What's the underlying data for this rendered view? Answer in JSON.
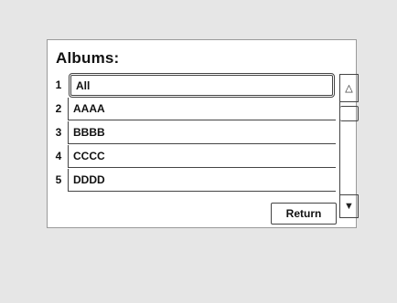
{
  "title": "Albums:",
  "list": [
    {
      "number": "1",
      "label": "All",
      "selected": true
    },
    {
      "number": "2",
      "label": "AAAA"
    },
    {
      "number": "3",
      "label": "BBBB"
    },
    {
      "number": "4",
      "label": "CCCC"
    },
    {
      "number": "5",
      "label": "DDDD"
    }
  ],
  "scrollbar": {
    "up_glyph": "△",
    "down_glyph": "▼"
  },
  "return_label": "Return"
}
